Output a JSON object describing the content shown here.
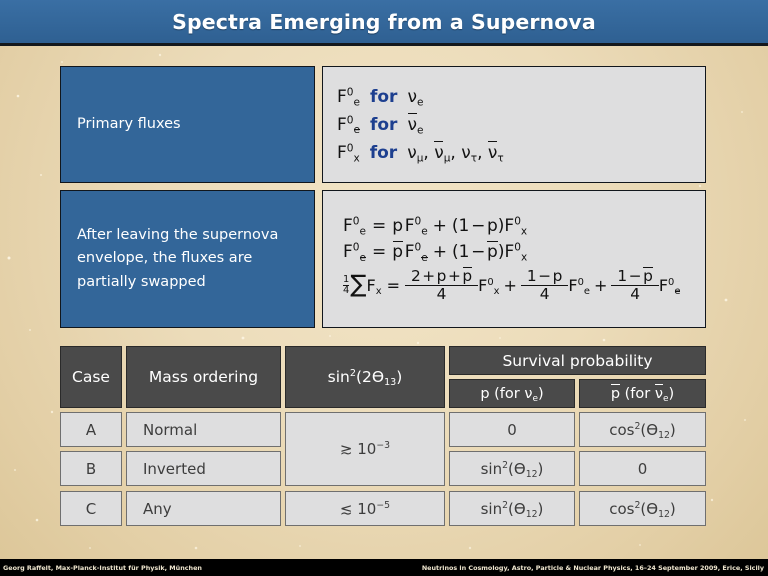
{
  "slide": {
    "title": "Spectra Emerging from a Supernova",
    "background_color": "#ead9b5",
    "accent_blue": "#336699",
    "header_gray": "#4a4a4a",
    "cell_gray": "#dededf"
  },
  "labels": {
    "primary_fluxes": "Primary fluxes",
    "after_leaving": "After leaving the supernova envelope, the fluxes are partially swapped"
  },
  "primary_flux_rows": [
    {
      "flux": "F0e",
      "flux_text": "F",
      "flux_sup": "0",
      "flux_sub": "e",
      "for_word": "for",
      "species": "νe"
    },
    {
      "flux": "F0ebar",
      "flux_text": "F",
      "flux_sup": "0",
      "flux_sub": "e",
      "for_word": "for",
      "species": "ν̄e"
    },
    {
      "flux": "F0x",
      "flux_text": "F",
      "flux_sup": "0",
      "flux_sub": "x",
      "for_word": "for",
      "species": "νμ, ν̄μ, ντ, ν̄τ"
    }
  ],
  "swap_equations": [
    "F0e = p F0e + (1 − p) F0x",
    "F0ebar = p̄ F0ebar + (1 − p̄) F0x",
    "(1/4) Σ Fx = (2 + p + p̄)/4 F0x + (1 − p)/4 F0e + (1 − p̄)/4 F0ebar"
  ],
  "table": {
    "headers": {
      "case": "Case",
      "mass_ordering": "Mass ordering",
      "sin2_2theta13": "sin2(2Θ13)",
      "survival_probability": "Survival probability",
      "p_for_nue": "p (for νe)",
      "pbar_for_nuebar": "p̄ (for ν̄e)"
    },
    "rows": [
      {
        "case": "A",
        "mass_ordering": "Normal",
        "sin2_2theta13": "≳ 10−3",
        "p": "0",
        "pbar": "cos2(Θ12)"
      },
      {
        "case": "B",
        "mass_ordering": "Inverted",
        "sin2_2theta13": "≳ 10−3",
        "p": "sin2(Θ12)",
        "pbar": "0"
      },
      {
        "case": "C",
        "mass_ordering": "Any",
        "sin2_2theta13": "≲ 10−5",
        "p": "sin2(Θ12)",
        "pbar": "cos2(Θ12)"
      }
    ],
    "sin_span_ab": "≳ 10−3",
    "sin_c": "≲ 10−5",
    "zero": "0"
  },
  "footer": {
    "left": "Georg Raffelt, Max-Planck-Institut für Physik, München",
    "right": "Neutrinos in Cosmology, Astro, Particle & Nuclear Physics, 16–24 September 2009, Erice, Sicily"
  }
}
